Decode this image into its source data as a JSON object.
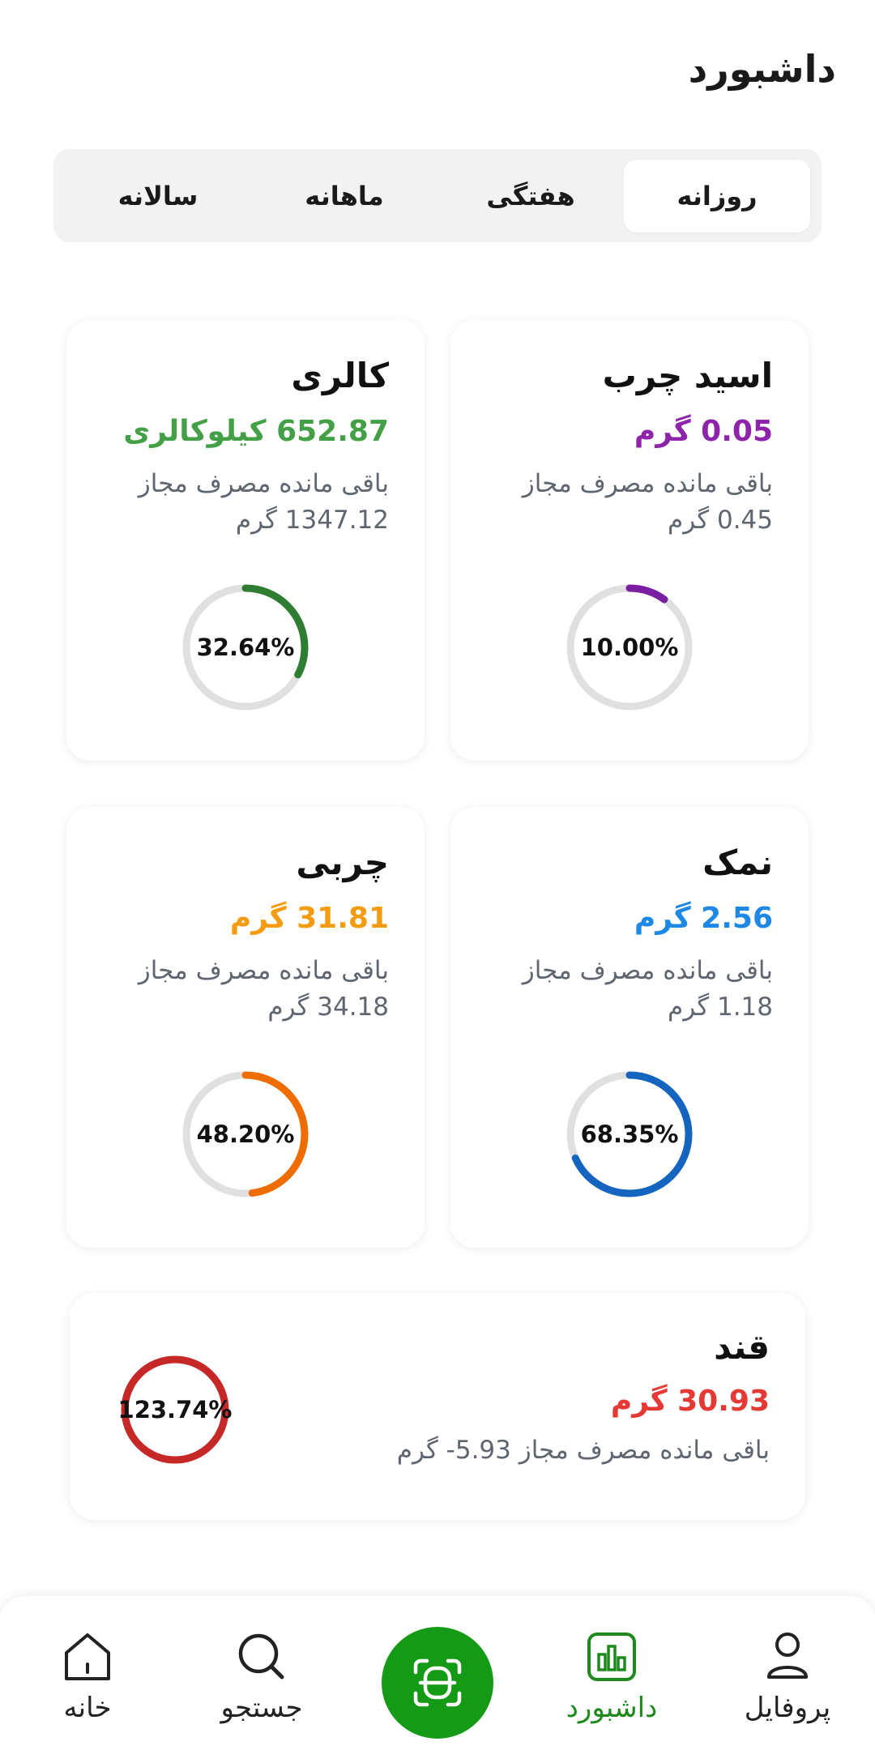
{
  "page": {
    "title": "داشبورد"
  },
  "tabs": [
    {
      "label": "روزانه",
      "active": true
    },
    {
      "label": "هفتگی",
      "active": false
    },
    {
      "label": "ماهانه",
      "active": false
    },
    {
      "label": "سالانه",
      "active": false
    }
  ],
  "cards": {
    "fatty_acid": {
      "title": "اسید چرب",
      "value": "0.05 گرم",
      "remain_label": "باقی مانده مصرف مجاز",
      "remain_value": "0.45 گرم",
      "percent": "10.00%",
      "progress": 0.1,
      "color": "#7b1fa2"
    },
    "calorie": {
      "title": "کالری",
      "value": "652.87 کیلوکالری",
      "remain_label": "باقی مانده مصرف مجاز",
      "remain_value": "1347.12 گرم",
      "percent": "32.64%",
      "progress": 0.3264,
      "color": "#2e7d32"
    },
    "salt": {
      "title": "نمک",
      "value": "2.56 گرم",
      "remain_label": "باقی مانده مصرف مجاز",
      "remain_value": "1.18 گرم",
      "percent": "68.35%",
      "progress": 0.6835,
      "color": "#1565c0"
    },
    "fat": {
      "title": "چربی",
      "value": "31.81 گرم",
      "remain_label": "باقی مانده مصرف مجاز",
      "remain_value": "34.18 گرم",
      "percent": "48.20%",
      "progress": 0.482,
      "color": "#ef6c00"
    },
    "sugar": {
      "title": "قند",
      "value": "30.93 گرم",
      "remain": "باقی مانده مصرف مجاز 5.93- گرم",
      "percent": "123.74%",
      "progress": 1.0,
      "color": "#c62828"
    }
  },
  "colors": {
    "fatty_acid_text": "#8e24aa",
    "calorie_text": "#43a047",
    "salt_text": "#1e88e5",
    "fat_text": "#f39c12",
    "sugar_text": "#e53935",
    "ring_track": "#e0e0e0",
    "accent": "#149a14"
  },
  "nav": {
    "items": [
      {
        "label": "پروفایل",
        "icon": "person-icon"
      },
      {
        "label": "داشبورد",
        "icon": "chart-icon",
        "active": true
      },
      {
        "label": "scan",
        "icon": "scan-icon"
      },
      {
        "label": "جستجو",
        "icon": "search-icon"
      },
      {
        "label": "خانه",
        "icon": "home-icon"
      }
    ],
    "profile": "پروفایل",
    "dashboard": "داشبورد",
    "search": "جستجو",
    "home": "خانه"
  }
}
